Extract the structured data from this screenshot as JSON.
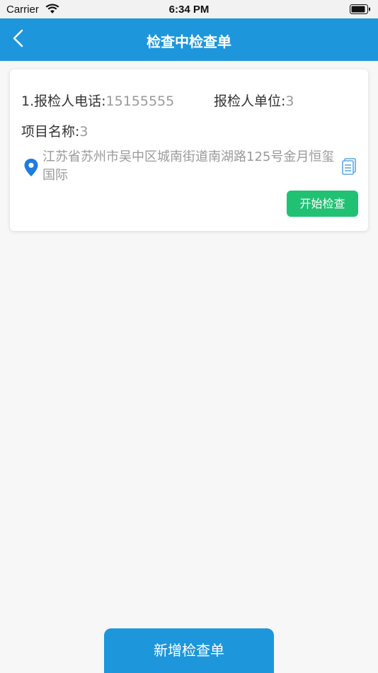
{
  "status_bar": {
    "carrier": "Carrier",
    "time": "6:34 PM"
  },
  "nav": {
    "title": "检查中检查单",
    "back_icon": "chevron-left-icon"
  },
  "card": {
    "phone_label": "1.报检人电话:",
    "phone_value": "15155555",
    "unit_label": "报检人单位:",
    "unit_value": "3",
    "project_label": "项目名称:",
    "project_value": "3",
    "address": "江苏省苏州市吴中区城南街道南湖路125号金月恒玺国际",
    "start_label": "开始检查"
  },
  "footer": {
    "add_label": "新增检查单"
  },
  "colors": {
    "primary": "#1e96dc",
    "success": "#21c173",
    "text": "#333333",
    "muted": "#9a9a9a",
    "background": "#f7f7f7"
  }
}
